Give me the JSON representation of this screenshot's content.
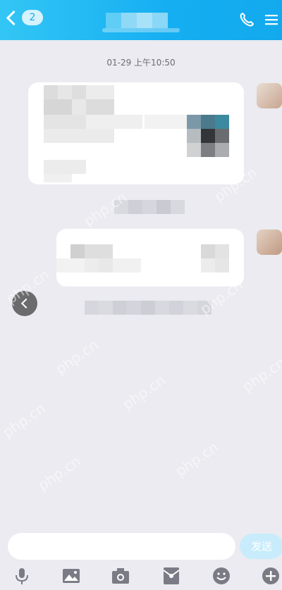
{
  "header": {
    "back_badge": "2",
    "colors": {
      "bar": "#15aef1",
      "badge_bg": "#d6f2fd"
    }
  },
  "conversation": {
    "timestamp": "01-29 上午10:50"
  },
  "composer": {
    "input_value": "",
    "send_label": "发送"
  },
  "toolbar": {
    "icons": [
      "microphone-icon",
      "image-icon",
      "camera-icon",
      "red-packet-icon",
      "emoji-icon",
      "plus-icon"
    ]
  },
  "watermark": "php.cn"
}
